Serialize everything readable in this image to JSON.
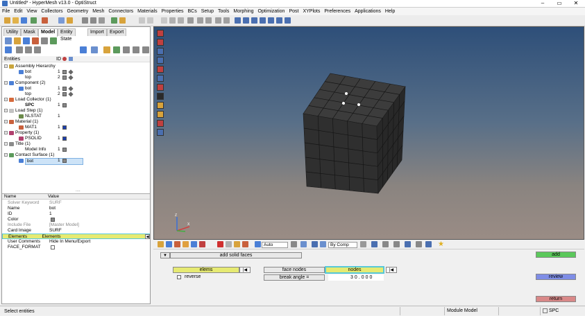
{
  "window": {
    "title": "Untitled* - HyperMesh v13.0 - OptiStruct"
  },
  "menu": [
    "File",
    "Edit",
    "View",
    "Collectors",
    "Geometry",
    "Mesh",
    "Connectors",
    "Materials",
    "Properties",
    "BCs",
    "Setup",
    "Tools",
    "Morphing",
    "Optimization",
    "Post",
    "XYPlots",
    "Preferences",
    "Applications",
    "Help"
  ],
  "left_tabs": [
    "Utility",
    "Mask",
    "Model",
    "Entity State",
    "Import",
    "Export"
  ],
  "tree": {
    "headers": {
      "entities": "Entities",
      "id": "ID"
    },
    "rows": [
      {
        "indent": 0,
        "label": "Assembly Hierarchy",
        "id": "",
        "sq": false,
        "cube": false,
        "exp": "-",
        "icolor": "#c9a53c"
      },
      {
        "indent": 2,
        "label": "bot",
        "id": "1",
        "sq": true,
        "cube": true,
        "icolor": "#4a7fd6"
      },
      {
        "indent": 2,
        "label": "top",
        "id": "2",
        "sq": true,
        "cube": true,
        "icolor": ""
      },
      {
        "indent": 0,
        "label": "Component (2)",
        "id": "",
        "exp": "-",
        "icolor": "#4a7fd6"
      },
      {
        "indent": 2,
        "label": "bot",
        "id": "1",
        "sq": true,
        "cube": true,
        "icolor": "#4a7fd6"
      },
      {
        "indent": 2,
        "label": "top",
        "id": "2",
        "sq": true,
        "cube": true,
        "icolor": ""
      },
      {
        "indent": 0,
        "label": "Load Collector (1)",
        "id": "",
        "exp": "-",
        "icolor": "#d66a3c"
      },
      {
        "indent": 2,
        "label": "SPC",
        "id": "1",
        "sq": true,
        "bold": true,
        "icolor": ""
      },
      {
        "indent": 0,
        "label": "Load Step (1)",
        "id": "",
        "exp": "-",
        "icolor": "#c3c3c3"
      },
      {
        "indent": 2,
        "label": "NLSTAT",
        "id": "1",
        "icolor": "#6b8a4a"
      },
      {
        "indent": 0,
        "label": "Material (1)",
        "id": "",
        "exp": "-",
        "icolor": "#c9603c"
      },
      {
        "indent": 2,
        "label": "MAT1",
        "id": "1",
        "sq": true,
        "sqfill": "#1b3fae",
        "icolor": "#c9603c"
      },
      {
        "indent": 0,
        "label": "Property (1)",
        "id": "",
        "exp": "-",
        "icolor": "#b0406e"
      },
      {
        "indent": 2,
        "label": "PSOLID",
        "id": "1",
        "sq": true,
        "sqfill": "#1b3fae",
        "icolor": "#b0406e"
      },
      {
        "indent": 0,
        "label": "Title (1)",
        "id": "",
        "exp": "-",
        "icolor": "#8a8a8a"
      },
      {
        "indent": 2,
        "label": "Model Info",
        "id": "1",
        "sq": true,
        "icolor": ""
      },
      {
        "indent": 0,
        "label": "Contact Surface (1)",
        "id": "",
        "exp": "-",
        "icolor": "#5c9a5c"
      },
      {
        "indent": 2,
        "label": "bot",
        "id": "1",
        "sq": true,
        "sel": true,
        "icolor": "#4a7fd6"
      }
    ]
  },
  "props": {
    "headers": {
      "name": "Name",
      "value": "Value"
    },
    "rows": [
      {
        "name": "Solver Keyword",
        "value": "SURF",
        "grey": true
      },
      {
        "name": "Name",
        "value": "bot"
      },
      {
        "name": "ID",
        "value": "1"
      },
      {
        "name": "Color",
        "value": "",
        "colorbox": true
      },
      {
        "name": "Include File",
        "value": "[Master Model]",
        "grey": true
      },
      {
        "name": "Card Image",
        "value": "SURF"
      },
      {
        "name": "Elements",
        "value": "Elements",
        "hl": true
      },
      {
        "name": "User Comments",
        "value": "Hide In Menu/Export"
      },
      {
        "name": "FACE_FORMAT",
        "value": "",
        "checkbox": true
      }
    ]
  },
  "viewport_toolbar": {
    "display_mode": "Auto",
    "color_by": "By Comp"
  },
  "panel": {
    "add_solid_faces": "add solid faces",
    "elems": "elems",
    "reverse": "reverse",
    "face_nodes": "face nodes",
    "nodes": "nodes",
    "break_angle": "break angle =",
    "break_angle_value": "30.000",
    "add": "add",
    "review": "review",
    "return": "return"
  },
  "status": {
    "message": "Select entities",
    "mode": "Module Model",
    "collector": "SPC"
  },
  "colors": {
    "viewport_top": "#2e4f79",
    "viewport_bottom": "#9a8c85",
    "cube": "#2d2d2d",
    "add_green": "#5bc85b",
    "review_blue": "#7e8de6",
    "return_red": "#d98888"
  }
}
